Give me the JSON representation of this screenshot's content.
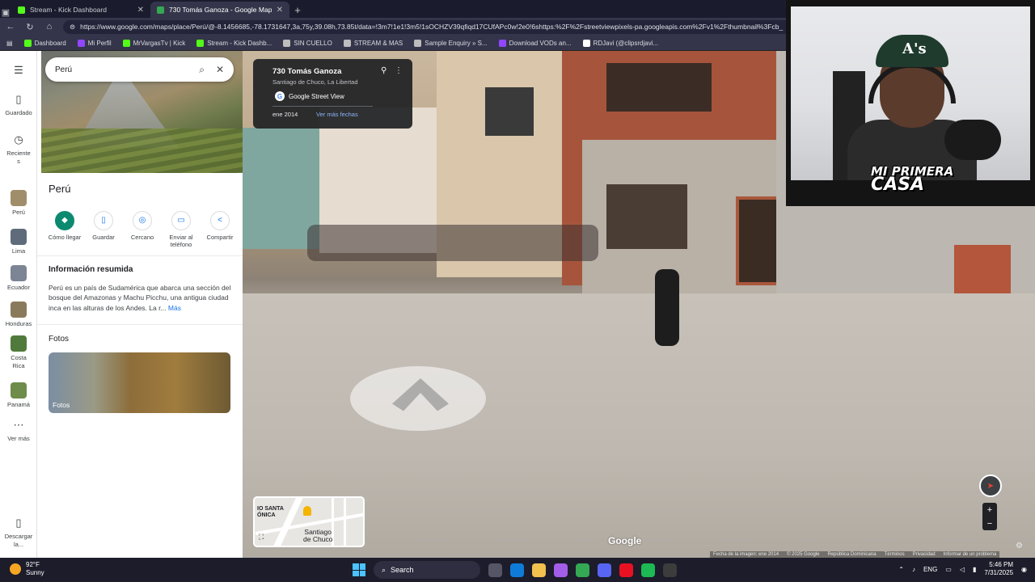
{
  "browser": {
    "tabs": [
      {
        "title": "Stream - Kick Dashboard",
        "active": false,
        "favicon_color": "#53fc18"
      },
      {
        "title": "730 Tomás Ganoza - Google Maps",
        "active": true,
        "favicon_color": "#34a853"
      }
    ],
    "url": "https://www.google.com/maps/place/Perú/@-8.1456685,-78.1731647,3a,75y,39.08h,73.85t/data=!3m7!1e1!3m5!1sOCHZV39qfiqd17CUfAPc0w!2e0!6shttps:%2F%2Fstreetviewpixels-pa.googleapis.com%2Fv1%2Fthumbnail%3Fcb_",
    "bookmarks": [
      {
        "label": "Dashboard",
        "icon_color": "#53fc18"
      },
      {
        "label": "Mi Perfil",
        "icon_color": "#9146ff"
      },
      {
        "label": "MrVargasTv | Kick",
        "icon_color": "#53fc18"
      },
      {
        "label": "Stream - Kick Dashb...",
        "icon_color": "#53fc18"
      },
      {
        "label": "SIN CUELLO",
        "icon_color": "#bdbdbd"
      },
      {
        "label": "STREAM & MAS",
        "icon_color": "#bdbdbd"
      },
      {
        "label": "Sample Enquiry » S...",
        "icon_color": "#bdbdbd"
      },
      {
        "label": "Download VODs an...",
        "icon_color": "#9146ff"
      },
      {
        "label": "RDJavi (@clipsrdjavi...",
        "icon_color": "#ffffff"
      }
    ]
  },
  "rail": {
    "menu_icon": "menu-icon",
    "saved": "Guardado",
    "recent_lines": [
      "Reciente",
      "s"
    ],
    "recents": [
      {
        "lines": [
          "Perú"
        ],
        "thumb": "#a08d6a"
      },
      {
        "lines": [
          "Lima"
        ],
        "thumb": "#5f6b7a"
      },
      {
        "lines": [
          "Ecuador"
        ],
        "thumb": "#7b8593"
      },
      {
        "lines": [
          "Honduras"
        ],
        "thumb": "#8a7a5c"
      },
      {
        "lines": [
          "Costa",
          "Rica"
        ],
        "thumb": "#4f7a3c"
      },
      {
        "lines": [
          "Panamá"
        ],
        "thumb": "#6e8c4a"
      }
    ],
    "more": "Ver más",
    "download_lines": [
      "Descargar",
      "la..."
    ]
  },
  "panel": {
    "search_query": "Perú",
    "place_title": "Perú",
    "actions": [
      {
        "lines": [
          "Cómo llegar"
        ],
        "icon": "directions-icon",
        "glyph": "◆",
        "primary": true
      },
      {
        "lines": [
          "Guardar"
        ],
        "icon": "bookmark-icon",
        "glyph": "▯",
        "primary": false
      },
      {
        "lines": [
          "Cercano"
        ],
        "icon": "nearby-icon",
        "glyph": "◎",
        "primary": false
      },
      {
        "lines": [
          "Enviar al",
          "teléfono"
        ],
        "icon": "phone-icon",
        "glyph": "▭",
        "primary": false
      },
      {
        "lines": [
          "Compartir"
        ],
        "icon": "share-icon",
        "glyph": "<",
        "primary": false
      }
    ],
    "summary_title": "Información resumida",
    "summary_text": "Perú es un país de Sudamérica que abarca una sección del bosque del Amazonas y Machu Picchu, una antigua ciudad inca en las alturas de los Andes. La r...",
    "summary_more": "Más",
    "photos_title": "Fotos",
    "photo_label": "Fotos"
  },
  "streetview": {
    "address": "730 Tomás Ganoza",
    "city": "Santiago de Chuco, La Libertad",
    "brand": "Google Street View",
    "date": "ene 2014",
    "more_dates": "Ver más fechas",
    "watermark": "Google",
    "attribution": [
      "Fecha de la imagen: ene 2014",
      "© 2025 Google",
      "República Dominicana",
      "Términos",
      "Privacidad",
      "Informar de un problema"
    ],
    "minimap": {
      "area_lines": [
        "IO SANTA",
        "ÓNICA"
      ],
      "town_lines": [
        "Santiago",
        "de Chuco"
      ]
    }
  },
  "webcam": {
    "overlay_lines": [
      "MI PRIMERA",
      "CASA"
    ]
  },
  "taskbar": {
    "temp": "92°F",
    "weather": "Sunny",
    "search": "Search",
    "lang": "ENG",
    "time": "5:46 PM",
    "date": "7/31/2025",
    "apps": [
      {
        "icon": "task-view-icon",
        "color": "#555566"
      },
      {
        "icon": "edge-icon",
        "color": "#0f7bd8"
      },
      {
        "icon": "folder-icon",
        "color": "#f2c14e"
      },
      {
        "icon": "copilot-icon",
        "color": "#a45de8"
      },
      {
        "icon": "chrome-icon",
        "color": "#34a853"
      },
      {
        "icon": "discord-icon",
        "color": "#5865f2"
      },
      {
        "icon": "opera-icon",
        "color": "#e81123"
      },
      {
        "icon": "spotify-icon",
        "color": "#1db954"
      },
      {
        "icon": "terminal-icon",
        "color": "#3c3c3c"
      }
    ]
  }
}
